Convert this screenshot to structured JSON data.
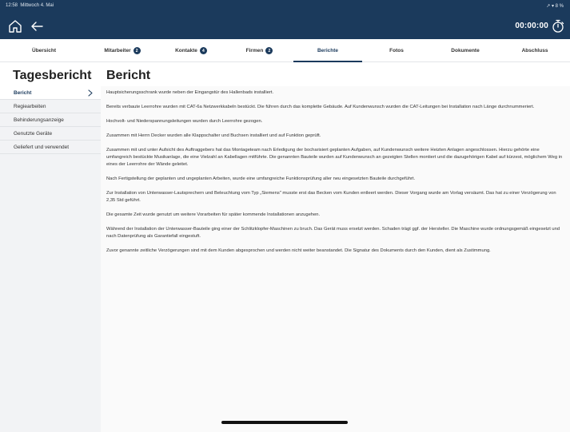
{
  "status": {
    "time": "12:58",
    "date": "Mittwoch 4. Mai",
    "indicators": "↗ ▾ 8 %"
  },
  "header": {
    "timer": "00:00:00",
    "bar_color": "#1b3a5c"
  },
  "tabs": [
    {
      "label": "Übersicht",
      "badge": ""
    },
    {
      "label": "Mitarbeiter",
      "badge": "2"
    },
    {
      "label": "Kontakte",
      "badge": "4"
    },
    {
      "label": "Firmen",
      "badge": "2"
    },
    {
      "label": "Berichte",
      "badge": ""
    },
    {
      "label": "Fotos",
      "badge": ""
    },
    {
      "label": "Dokumente",
      "badge": ""
    },
    {
      "label": "Abschluss",
      "badge": ""
    }
  ],
  "active_tab": "Berichte",
  "page": {
    "title": "Tagesbericht",
    "section_title": "Bericht"
  },
  "sidebar": {
    "items": [
      {
        "label": "Bericht"
      },
      {
        "label": "Regiearbeiten"
      },
      {
        "label": "Behinderungsanzeige"
      },
      {
        "label": "Genutzte Geräte"
      },
      {
        "label": "Geliefert und verwendet"
      }
    ],
    "selected": "Bericht"
  },
  "report": {
    "paragraphs": [
      "Hauptsicherungsschrank wurde neben der Eingangstür des Hallenbads installiert.",
      "Bereits verbaute Leerrohre wurden mit CAT-6a Netzwerkkabeln bestückt. Die führen durch das komplette Gebäude. Auf Kundenwunsch wurden die CAT-Leitungen bei Installation nach Länge durchnummeriert.",
      "Hochvolt- und Niederspannungsleitungen wurden durch Leerrohre gezogen.",
      "Zusammen mit Herrn Decker wurden alle Klappschalter und Buchsen installiert und auf Funktion geprüft.",
      "Zusammen mit und unter Aufsicht des Auftraggebers hat das Montageteam nach Erledigung der bocharisiert geplanten Aufgaben, auf Kundenwunsch weitere Heizten Anlagen angeschlossen. Hierzu gehörte eine umfangreich bestückte Musikanlage, die eine Vielzahl an Kabellagen mitführte. Die genannten Bauteile wurden auf Kundenwunsch an gezeigten Stellen montiert und die dazugehörigen Kabel auf kürzest, möglichem Weg in eines der Leerrohre der Wände geleitet.",
      "Nach Fertigstellung der geplanten und ungeplanten Arbeiten, wurde eine umfangreiche Funktionsprüfung aller neu eingesetzten Bauteile durchgeführt.",
      "Zur Installation von Unterwasser-Lautsprechern und Beleuchtung vom Typ „Siemens\" musste erst das Becken vom Kunden entleert werden. Dieser Vorgang wurde am Vorlag versäumt. Das hat zu einer Verzögerung von 2,35 Std geführt.",
      "Die gesamte Zeit wurde genutzt um weitere Vorarbeiten für später kommende Installationen anzugehen.",
      "Während der Installation der Unterwasser-Bauteile ging einer der Schlitzklopfer-Maschinen zu bruch. Das Gerät muss ersetzt werden. Schaden trägt ggf. der Hersteller. Die Maschine wurde ordnungsgemäß eingesetzt und nach Datenprüfung als Garantiefall eingestuft.",
      "Zuvor genannte zeitliche Verzögerungen sind mit dem Kunden abgesprochen und werden nicht weiter beanstandet. Die Signatur des Dokuments durch den Kunden, dient als Zustimmung."
    ]
  },
  "icons": {
    "home": "home-icon",
    "back": "arrow-left-icon",
    "timer": "stopwatch-icon",
    "chevron": "chevron-right-icon"
  }
}
